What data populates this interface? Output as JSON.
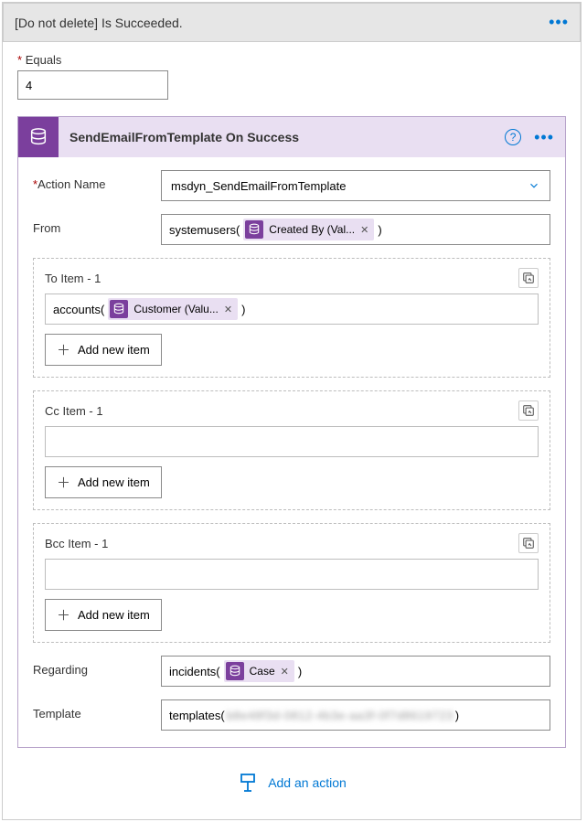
{
  "header": {
    "title": "[Do not delete] Is Succeeded."
  },
  "equals": {
    "label": "Equals",
    "value": "4"
  },
  "card": {
    "title": "SendEmailFromTemplate On Success",
    "actionName": {
      "label": "Action Name",
      "value": "msdyn_SendEmailFromTemplate"
    },
    "from": {
      "label": "From",
      "prefix": "systemusers(",
      "pill": "Created By (Val...",
      "suffix": ")"
    },
    "to": {
      "label": "To Item - 1",
      "prefix": "accounts(",
      "pill": "Customer (Valu...",
      "suffix": ")",
      "add": "Add new item"
    },
    "cc": {
      "label": "Cc Item - 1",
      "add": "Add new item"
    },
    "bcc": {
      "label": "Bcc Item - 1",
      "add": "Add new item"
    },
    "regarding": {
      "label": "Regarding",
      "prefix": "incidents(",
      "pill": "Case",
      "suffix": ")"
    },
    "template": {
      "label": "Template",
      "prefix": "templates(",
      "blur": "b8e48f3d-0812-4b3e-aa3f-0f7d8619723",
      "suffix": ")"
    }
  },
  "addAction": "Add an action"
}
